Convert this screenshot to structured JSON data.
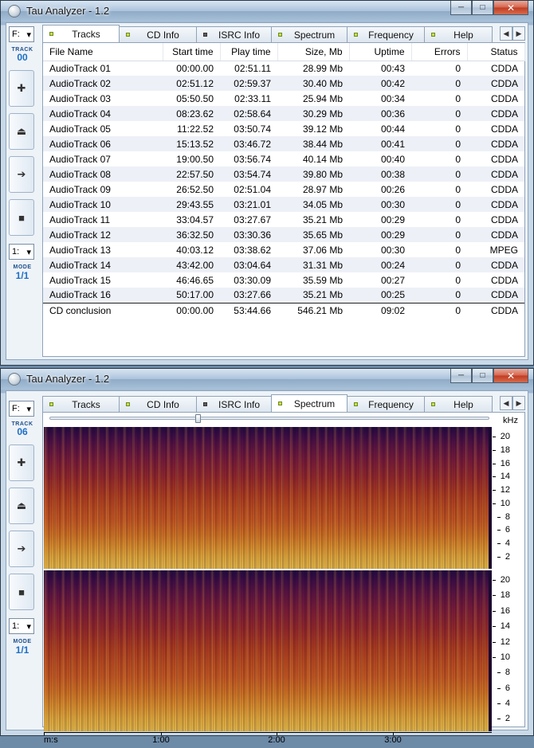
{
  "window1": {
    "title": "Tau Analyzer - 1.2",
    "drive": "F:",
    "track_label": "TRACK",
    "track_number": "00",
    "mode_select": "1:",
    "mode_label": "MODE",
    "mode_value": "1/1",
    "active_tab": "Tracks"
  },
  "window2": {
    "title": "Tau Analyzer - 1.2",
    "drive": "F:",
    "track_label": "TRACK",
    "track_number": "06",
    "mode_select": "1:",
    "mode_label": "MODE",
    "mode_value": "1/1",
    "active_tab": "Spectrum"
  },
  "controls": {
    "minimize": "─",
    "maximize": "□",
    "close": "✕"
  },
  "tabs": [
    "Tracks",
    "CD Info",
    "ISRC Info",
    "Spectrum",
    "Frequency",
    "Help"
  ],
  "tab_leds": [
    "green",
    "green",
    "gray",
    "green",
    "green",
    "green"
  ],
  "icons": {
    "add": "plus-icon",
    "eject": "eject-icon",
    "next": "arrow-right-icon",
    "stop": "stop-icon",
    "tab_left": "chevron-left-icon",
    "tab_right": "chevron-right-icon"
  },
  "table": {
    "headers": [
      "File Name",
      "Start time",
      "Play time",
      "Size, Mb",
      "Uptime",
      "Errors",
      "Status"
    ],
    "rows": [
      [
        "AudioTrack 01",
        "00:00.00",
        "02:51.11",
        "28.99 Mb",
        "00:43",
        "0",
        "CDDA"
      ],
      [
        "AudioTrack 02",
        "02:51.12",
        "02:59.37",
        "30.40 Mb",
        "00:42",
        "0",
        "CDDA"
      ],
      [
        "AudioTrack 03",
        "05:50.50",
        "02:33.11",
        "25.94 Mb",
        "00:34",
        "0",
        "CDDA"
      ],
      [
        "AudioTrack 04",
        "08:23.62",
        "02:58.64",
        "30.29 Mb",
        "00:36",
        "0",
        "CDDA"
      ],
      [
        "AudioTrack 05",
        "11:22.52",
        "03:50.74",
        "39.12 Mb",
        "00:44",
        "0",
        "CDDA"
      ],
      [
        "AudioTrack 06",
        "15:13.52",
        "03:46.72",
        "38.44 Mb",
        "00:41",
        "0",
        "CDDA"
      ],
      [
        "AudioTrack 07",
        "19:00.50",
        "03:56.74",
        "40.14 Mb",
        "00:40",
        "0",
        "CDDA"
      ],
      [
        "AudioTrack 08",
        "22:57.50",
        "03:54.74",
        "39.80 Mb",
        "00:38",
        "0",
        "CDDA"
      ],
      [
        "AudioTrack 09",
        "26:52.50",
        "02:51.04",
        "28.97 Mb",
        "00:26",
        "0",
        "CDDA"
      ],
      [
        "AudioTrack 10",
        "29:43.55",
        "03:21.01",
        "34.05 Mb",
        "00:30",
        "0",
        "CDDA"
      ],
      [
        "AudioTrack 11",
        "33:04.57",
        "03:27.67",
        "35.21 Mb",
        "00:29",
        "0",
        "CDDA"
      ],
      [
        "AudioTrack 12",
        "36:32.50",
        "03:30.36",
        "35.65 Mb",
        "00:29",
        "0",
        "CDDA"
      ],
      [
        "AudioTrack 13",
        "40:03.12",
        "03:38.62",
        "37.06 Mb",
        "00:30",
        "0",
        "MPEG"
      ],
      [
        "AudioTrack 14",
        "43:42.00",
        "03:04.64",
        "31.31 Mb",
        "00:24",
        "0",
        "CDDA"
      ],
      [
        "AudioTrack 15",
        "46:46.65",
        "03:30.09",
        "35.59 Mb",
        "00:27",
        "0",
        "CDDA"
      ],
      [
        "AudioTrack 16",
        "50:17.00",
        "03:27.66",
        "35.21 Mb",
        "00:25",
        "0",
        "CDDA"
      ]
    ],
    "conclusion": [
      "CD conclusion",
      "00:00.00",
      "53:44.66",
      "546.21 Mb",
      "09:02",
      "0",
      "CDDA"
    ]
  },
  "spectrum": {
    "unit_label": "kHz",
    "y_ticks": [
      "20",
      "18",
      "16",
      "14",
      "12",
      "10",
      "8",
      "6",
      "4",
      "2"
    ],
    "x_unit": "m:s",
    "x_ticks": [
      "1:00",
      "2:00",
      "3:00"
    ],
    "slider_value": 0.33
  }
}
